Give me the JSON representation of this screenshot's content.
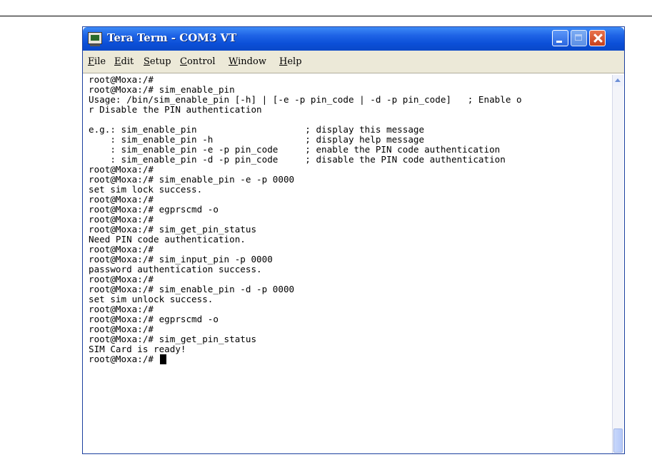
{
  "window": {
    "title": "Tera Term - COM3 VT"
  },
  "menu": [
    "File",
    "Edit",
    "Setup",
    "Control",
    "Window",
    "Help"
  ],
  "terminal": {
    "lines": [
      "root@Moxa:/#",
      "root@Moxa:/# sim_enable_pin",
      "Usage: /bin/sim_enable_pin [-h] | [-e -p pin_code | -d -p pin_code]   ; Enable o",
      "r Disable the PIN authentication",
      "",
      "e.g.: sim_enable_pin                    ; display this message",
      "    : sim_enable_pin -h                 ; display help message",
      "    : sim_enable_pin -e -p pin_code     ; enable the PIN code authentication",
      "    : sim_enable_pin -d -p pin_code     ; disable the PIN code authentication",
      "root@Moxa:/#",
      "root@Moxa:/# sim_enable_pin -e -p 0000",
      "set sim lock success.",
      "root@Moxa:/#",
      "root@Moxa:/# egprscmd -o",
      "root@Moxa:/#",
      "root@Moxa:/# sim_get_pin_status",
      "Need PIN code authentication.",
      "root@Moxa:/#",
      "root@Moxa:/# sim_input_pin -p 0000",
      "password authentication success.",
      "root@Moxa:/#",
      "root@Moxa:/# sim_enable_pin -d -p 0000",
      "set sim unlock success.",
      "root@Moxa:/#",
      "root@Moxa:/# egprscmd -o",
      "root@Moxa:/#",
      "root@Moxa:/# sim_get_pin_status",
      "SIM Card is ready!",
      "root@Moxa:/# "
    ]
  },
  "icons": {
    "app": "tera-term-icon",
    "minimize": "minimize-icon",
    "maximize": "maximize-icon",
    "close": "close-icon"
  },
  "colors": {
    "titlebar": "#0a48c8",
    "menubar": "#ece9d8",
    "close_button": "#c5401c"
  }
}
